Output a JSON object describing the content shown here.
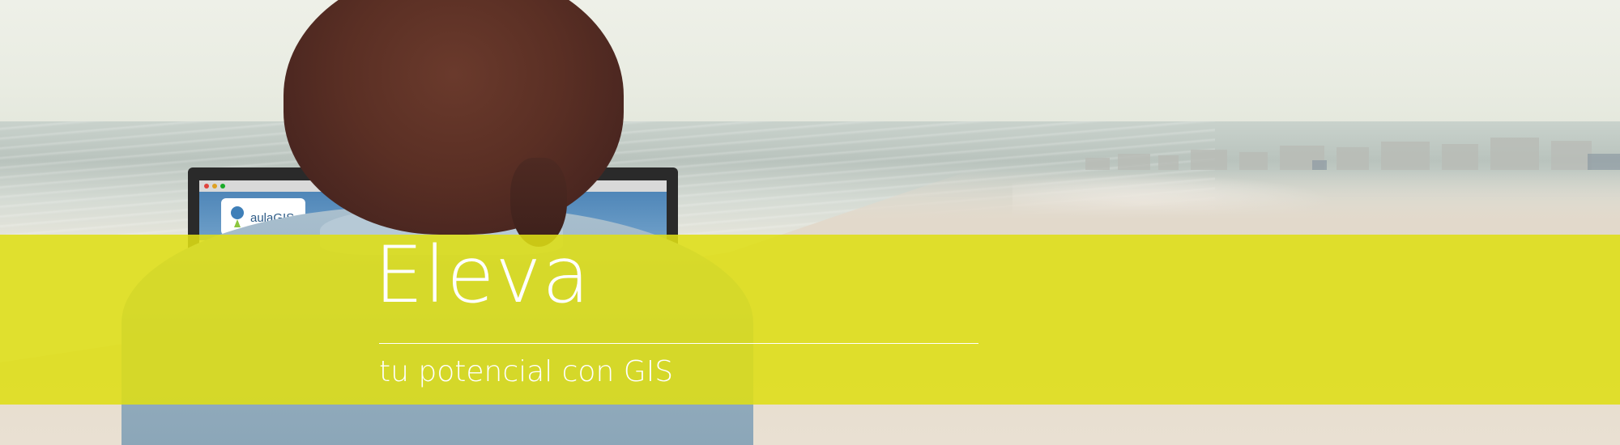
{
  "headline": "Eleva",
  "tagline": "tu potencial con GIS",
  "laptop_screen": {
    "logo_text": "aulaGIS"
  },
  "colors": {
    "band": "#dede14",
    "text": "#ffffff",
    "sky": "#eef0e8",
    "sand": "#e6dccd",
    "hair": "#5a2f24",
    "shirt": "#96afc0"
  }
}
